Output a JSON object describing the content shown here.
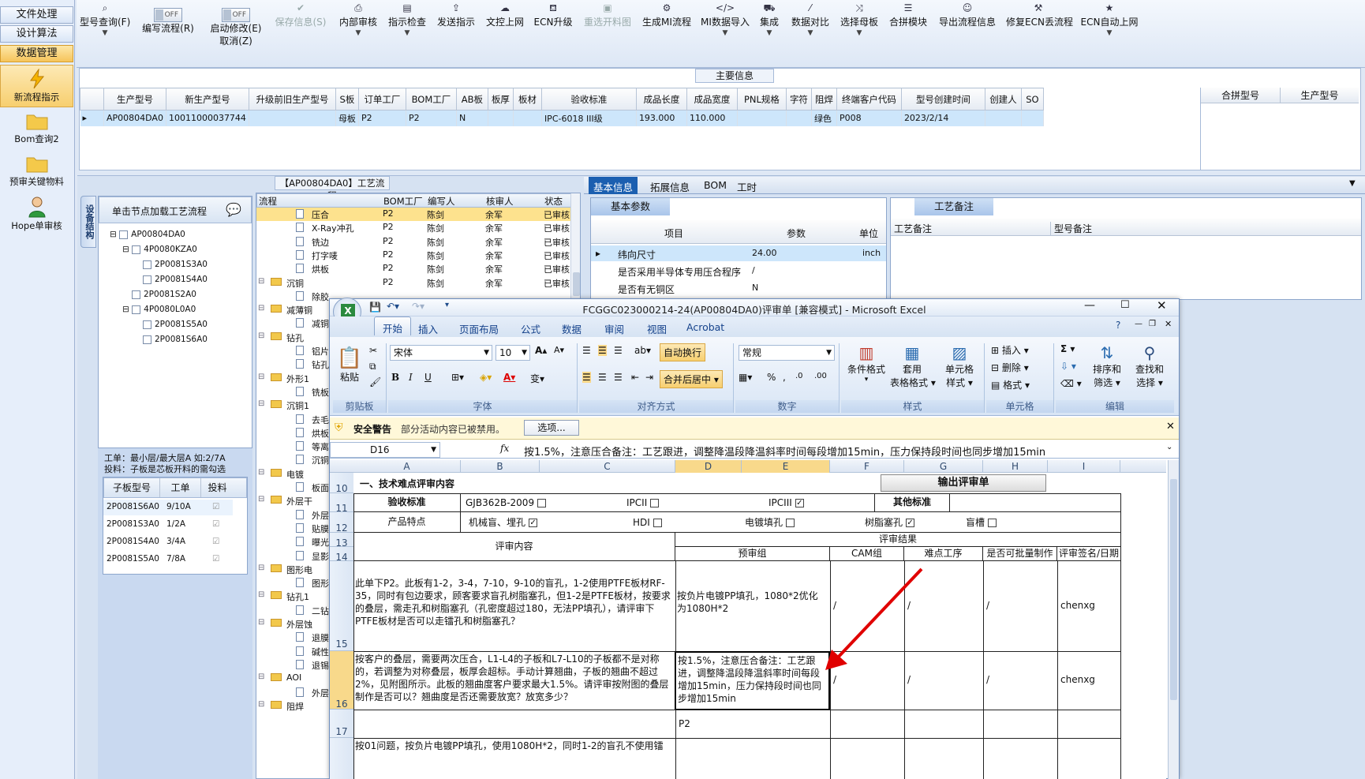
{
  "leftnav": {
    "top_items": [
      "文件处理",
      "设计算法",
      "数据管理"
    ],
    "items": [
      {
        "label": "新流程指示",
        "icon": "lightning-icon"
      },
      {
        "label": "Bom查询2",
        "icon": "folder-icon"
      },
      {
        "label": "预审关键物料",
        "icon": "folder-icon"
      },
      {
        "label": "Hope单审核",
        "icon": "user-icon"
      }
    ]
  },
  "toolbar": {
    "buttons": [
      {
        "label": "型号查询(F)",
        "icon": "search-icon"
      },
      {
        "label": "编写流程(R)",
        "switch": "OFF"
      },
      {
        "label": "启动修改(E)",
        "sub": "取消(Z)",
        "switch": "OFF"
      },
      {
        "label": "保存信息(S)",
        "icon": "check-icon"
      },
      {
        "label": "内部审核",
        "icon": "print-icon"
      },
      {
        "label": "指示检查",
        "icon": "clipboard-icon"
      },
      {
        "label": "发送指示",
        "icon": "upload-icon"
      },
      {
        "label": "文控上网",
        "icon": "cloud-icon"
      },
      {
        "label": "ECN升级",
        "icon": "tag-icon"
      },
      {
        "label": "重选开料图",
        "icon": "image-icon"
      },
      {
        "label": "生成MI流程",
        "icon": "gear-icon"
      },
      {
        "label": "MI数据导入",
        "icon": "code-icon"
      },
      {
        "label": "集成",
        "icon": "cart-icon"
      },
      {
        "label": "数据对比",
        "icon": "wand-icon"
      },
      {
        "label": "选择母板",
        "icon": "shuffle-icon"
      },
      {
        "label": "合拼模块",
        "icon": "list-icon"
      },
      {
        "label": "导出流程信息",
        "icon": "smile-icon"
      },
      {
        "label": "修复ECN丢流程",
        "icon": "wrench-icon"
      },
      {
        "label": "ECN自动上网",
        "icon": "star-icon"
      }
    ]
  },
  "main_info": {
    "title": "主要信息",
    "columns": [
      "生产型号",
      "新生产型号",
      "升级前旧生产型号",
      "S板",
      "订单工厂",
      "BOM工厂",
      "AB板",
      "板厚",
      "板材",
      "验收标准",
      "成品长度",
      "成品宽度",
      "PNL规格",
      "字符",
      "阻焊",
      "终端客户代码",
      "型号创建时间",
      "创建人",
      "SO"
    ],
    "row": [
      "AP00804DA0",
      "10011000037744",
      "",
      "母板",
      "P2",
      "P2",
      "N",
      "",
      "",
      "IPC-6018 III级",
      "193.000",
      "110.000",
      "",
      "",
      "绿色",
      "P008",
      "2023/2/14",
      "",
      ""
    ],
    "right_columns": [
      "合拼型号",
      "生产型号"
    ]
  },
  "process": {
    "title": "【AP00804DA0】工艺流程",
    "side_tab": "设备结构",
    "tree_header": "单击节点加载工艺流程",
    "tree": [
      {
        "label": "AP00804DA0",
        "level": 0
      },
      {
        "label": "4P0080KZA0",
        "level": 1
      },
      {
        "label": "2P0081S3A0",
        "level": 2
      },
      {
        "label": "2P0081S4A0",
        "level": 2
      },
      {
        "label": "2P0081S2A0",
        "level": 1
      },
      {
        "label": "4P0080L0A0",
        "level": 1
      },
      {
        "label": "2P0081S5A0",
        "level": 2
      },
      {
        "label": "2P0081S6A0",
        "level": 2
      }
    ],
    "note1": "工单：最小层/最大层A 如:2/7A",
    "note2": "投料：子板是芯板开料的需勾选",
    "sub_columns": [
      "子板型号",
      "工单",
      "投料"
    ],
    "sub_rows": [
      [
        "2P0081S6A0",
        "9/10A"
      ],
      [
        "2P0081S3A0",
        "1/2A"
      ],
      [
        "2P0081S4A0",
        "3/4A"
      ],
      [
        "2P0081S5A0",
        "7/8A"
      ]
    ],
    "flow_columns": [
      "流程",
      "BOM工厂",
      "编写人",
      "核审人",
      "状态"
    ],
    "flow_rows": [
      {
        "name": "压合",
        "type": "doc",
        "bom": "P2",
        "writer": "陈剑",
        "checker": "余军",
        "status": "已审核",
        "sel": true
      },
      {
        "name": "X-Ray冲孔",
        "type": "doc",
        "bom": "P2",
        "writer": "陈剑",
        "checker": "余军",
        "status": "已审核"
      },
      {
        "name": "铣边",
        "type": "doc",
        "bom": "P2",
        "writer": "陈剑",
        "checker": "余军",
        "status": "已审核"
      },
      {
        "name": "打字唛",
        "type": "doc",
        "bom": "P2",
        "writer": "陈剑",
        "checker": "余军",
        "status": "已审核"
      },
      {
        "name": "烘板",
        "type": "doc",
        "bom": "P2",
        "writer": "陈剑",
        "checker": "余军",
        "status": "已审核"
      },
      {
        "name": "沉铜",
        "type": "folder",
        "bom": "P2",
        "writer": "陈剑",
        "checker": "余军",
        "status": "已审核"
      },
      {
        "name": "除胶",
        "type": "doc"
      },
      {
        "name": "减薄铜",
        "type": "folder"
      },
      {
        "name": "减铜",
        "type": "doc"
      },
      {
        "name": "钻孔",
        "type": "folder"
      },
      {
        "name": "铝片",
        "type": "doc"
      },
      {
        "name": "钻孔",
        "type": "doc"
      },
      {
        "name": "外形1",
        "type": "folder"
      },
      {
        "name": "铣板",
        "type": "doc"
      },
      {
        "name": "沉铜1",
        "type": "folder"
      },
      {
        "name": "去毛",
        "type": "doc"
      },
      {
        "name": "烘板",
        "type": "doc"
      },
      {
        "name": "等离",
        "type": "doc"
      },
      {
        "name": "沉铜",
        "type": "doc"
      },
      {
        "name": "电镀",
        "type": "folder"
      },
      {
        "name": "板面",
        "type": "doc"
      },
      {
        "name": "外层干",
        "type": "folder"
      },
      {
        "name": "外层",
        "type": "doc"
      },
      {
        "name": "贴膜",
        "type": "doc"
      },
      {
        "name": "曝光",
        "type": "doc"
      },
      {
        "name": "显影",
        "type": "doc"
      },
      {
        "name": "图形电",
        "type": "folder"
      },
      {
        "name": "图形",
        "type": "doc"
      },
      {
        "name": "钻孔1",
        "type": "folder"
      },
      {
        "name": "二钻",
        "type": "doc"
      },
      {
        "name": "外层蚀",
        "type": "folder"
      },
      {
        "name": "退膜",
        "type": "doc"
      },
      {
        "name": "碱性",
        "type": "doc"
      },
      {
        "name": "退锡",
        "type": "doc"
      },
      {
        "name": "AOI",
        "type": "folder"
      },
      {
        "name": "外层",
        "type": "doc"
      },
      {
        "name": "阻焊",
        "type": "folder"
      }
    ]
  },
  "info_tabs": [
    "基本信息",
    "拓展信息",
    "BOM",
    "工时"
  ],
  "basic_params": {
    "tab": "基本参数",
    "columns": [
      "项目",
      "参数",
      "单位"
    ],
    "rows": [
      [
        "纬向尺寸",
        "24.00",
        "inch"
      ],
      [
        "是否采用半导体专用压合程序",
        "/",
        ""
      ],
      [
        "是否有无铜区",
        "N",
        ""
      ]
    ]
  },
  "remarks": {
    "tab": "工艺备注",
    "col1": "工艺备注",
    "col2": "型号备注"
  },
  "excel": {
    "title": "FCGGC023000214-24(AP00804DA0)评审单  [兼容模式] - Microsoft Excel",
    "tabs": [
      "开始",
      "插入",
      "页面布局",
      "公式",
      "数据",
      "审阅",
      "视图",
      "Acrobat"
    ],
    "font_name": "宋体",
    "font_size": "10",
    "number_format": "常规",
    "groups": [
      "剪贴板",
      "字体",
      "对齐方式",
      "数字",
      "样式",
      "单元格",
      "编辑"
    ],
    "buttons": {
      "paste": "粘贴",
      "wrap": "自动换行",
      "merge": "合并后居中",
      "cond": "条件格式",
      "table1": "套用",
      "table2": "表格格式",
      "style1": "单元格",
      "style2": "样式",
      "insert": "插入",
      "delete": "删除",
      "format": "格式",
      "sort1": "排序和",
      "sort2": "筛选",
      "find1": "查找和",
      "find2": "选择"
    },
    "security": {
      "title": "安全警告",
      "msg": "部分活动内容已被禁用。",
      "btn": "选项..."
    },
    "name_box": "D16",
    "formula": "按1.5%，注意压合备注：工艺跟进，调整降温段降温斜率时间每段增加15min，压力保持段时间也同步增加15min",
    "col_letters": [
      "A",
      "B",
      "C",
      "D",
      "E",
      "F",
      "G",
      "H",
      "I"
    ],
    "row_numbers": [
      "10",
      "11",
      "12",
      "13",
      "14",
      "15",
      "16",
      "17"
    ],
    "sheet": {
      "section": "一、技术难点评审内容",
      "output_btn": "输出评审单",
      "accept_std": "验收标准",
      "std_opts": [
        {
          "label": "GJB362B-2009",
          "checked": ""
        },
        {
          "label": "IPCII",
          "checked": ""
        },
        {
          "label": "IPCIII",
          "checked": "✓"
        }
      ],
      "other_std": "其他标准",
      "product_feat": "产品特点",
      "feat_opts": [
        {
          "label": "机械盲、埋孔",
          "checked": "✓"
        },
        {
          "label": "HDI",
          "checked": ""
        },
        {
          "label": "电镀填孔",
          "checked": ""
        },
        {
          "label": "树脂塞孔",
          "checked": "✓"
        },
        {
          "label": "盲槽",
          "checked": ""
        }
      ],
      "review_content": "评审内容",
      "review_result": "评审结果",
      "sub_headers": [
        "预审组",
        "CAM组",
        "难点工序",
        "是否可批量制作",
        "评审签名/日期"
      ],
      "row15": {
        "content": "此单下P2。此板有1-2，3-4，7-10，9-10的盲孔，1-2使用PTFE板材RF-35，同时有包边要求，顾客要求盲孔树脂塞孔，但1-2是PTFE板材，按要求的叠层，需走孔和树脂塞孔（孔密度超过180，无法PP填孔），请评审下PTFE板材是否可以走镭孔和树脂塞孔？",
        "pre": "按负片电镀PP填孔，1080*2优化为1080H*2",
        "cam": "/",
        "hard": "/",
        "batch": "/",
        "sign": "chenxg"
      },
      "row16": {
        "content": "按客户的叠层，需要两次压合，L1-L4的子板和L7-L10的子板都不是对称的，若调整为对称叠层，板厚会超标。手动计算翘曲，子板的翘曲不超过2%，见附图所示。此板的翘曲度客户要求最大1.5%。请评审按附图的叠层制作是否可以？翘曲度是否还需要放宽？放宽多少？",
        "pre": "按1.5%，注意压合备注：工艺跟进，调整降温段降温斜率时间每段增加15min，压力保持段时间也同步增加15min",
        "cam": "/",
        "hard": "/",
        "batch": "/",
        "sign": "chenxg"
      },
      "row17": {
        "pre": "P2"
      },
      "row18_partial": "按01问题，按负片电镀PP填孔，使用1080H*2，同时1-2的盲孔不使用镭"
    }
  }
}
